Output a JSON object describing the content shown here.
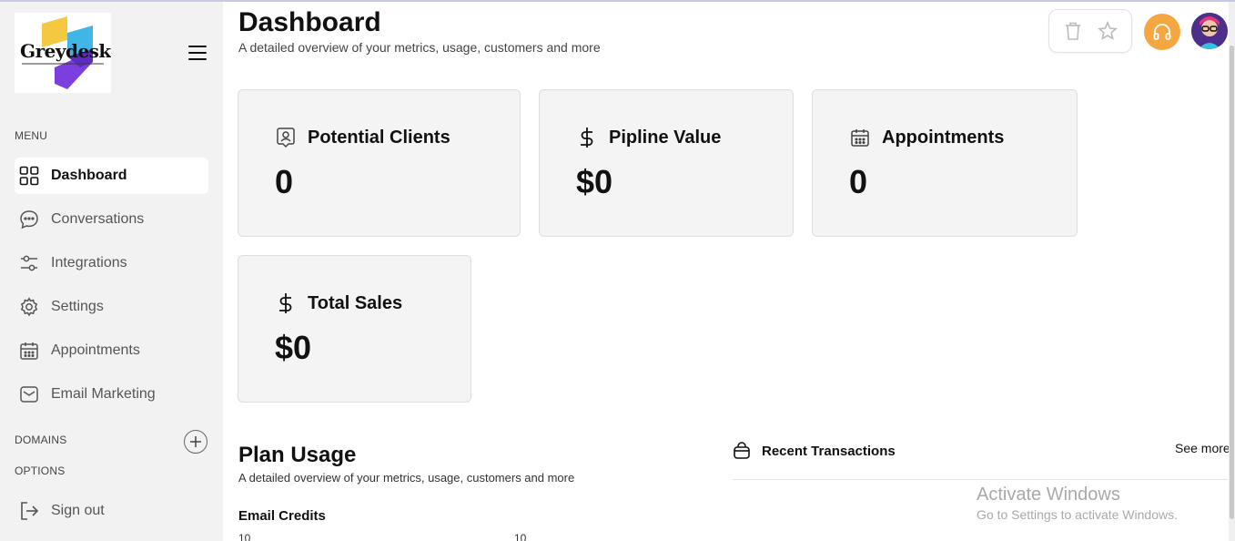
{
  "brand": {
    "logo_text": "Greydesk"
  },
  "sidebar": {
    "menu_label": "MENU",
    "items": [
      {
        "label": "Dashboard",
        "icon": "grid-icon",
        "active": true
      },
      {
        "label": "Conversations",
        "icon": "chat-icon",
        "active": false
      },
      {
        "label": "Integrations",
        "icon": "sliders-icon",
        "active": false
      },
      {
        "label": "Settings",
        "icon": "gear-icon",
        "active": false
      },
      {
        "label": "Appointments",
        "icon": "calendar-icon",
        "active": false
      },
      {
        "label": "Email Marketing",
        "icon": "mail-icon",
        "active": false
      }
    ],
    "domains_label": "DOMAINS",
    "options_label": "OPTIONS",
    "signout_label": "Sign out"
  },
  "header": {
    "title": "Dashboard",
    "subtitle": "A detailed overview of your metrics, usage, customers and more"
  },
  "cards": [
    {
      "title": "Potential Clients",
      "value": "0",
      "icon": "person-badge-icon"
    },
    {
      "title": "Pipline Value",
      "value": "$0",
      "icon": "dollar-icon"
    },
    {
      "title": "Appointments",
      "value": "0",
      "icon": "calendar-icon"
    },
    {
      "title": "Total Sales",
      "value": "$0",
      "icon": "dollar-icon"
    }
  ],
  "plan": {
    "title": "Plan Usage",
    "subtitle": "A detailed overview of your metrics, usage, customers and more",
    "email_credits_label": "Email Credits",
    "credits_used": "10",
    "credits_total": "10"
  },
  "transactions": {
    "title": "Recent Transactions",
    "see_more": "See more"
  },
  "watermark": {
    "line1": "Activate Windows",
    "line2": "Go to Settings to activate Windows."
  },
  "colors": {
    "sidebar_bg": "#f2f2f2",
    "card_bg": "#f4f4f4",
    "support_orange": "#f4a640"
  }
}
